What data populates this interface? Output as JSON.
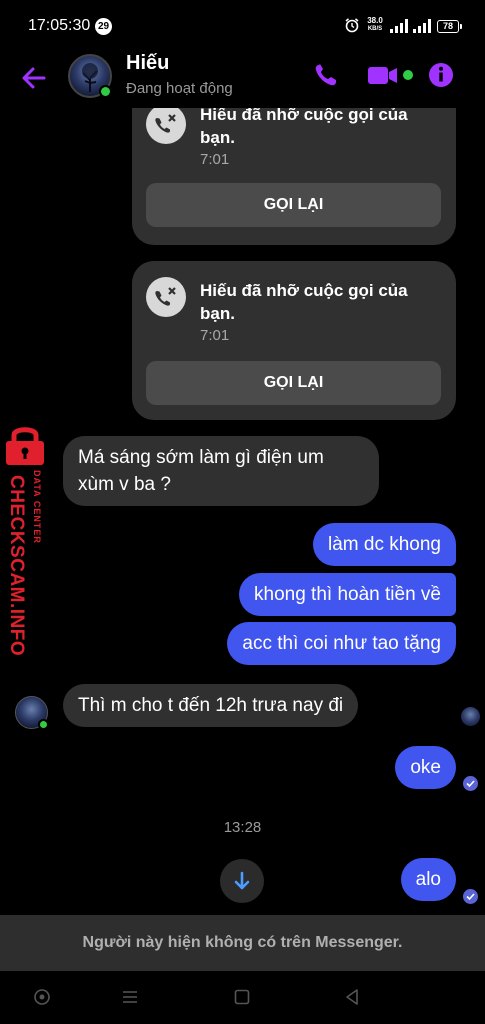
{
  "status_bar": {
    "time": "17:05:30",
    "notification_count": "29",
    "net_speed_value": "38.0",
    "net_speed_unit": "KB/S",
    "battery": "78"
  },
  "header": {
    "contact_name": "Hiếu",
    "contact_status": "Đang hoạt động",
    "accent_color": "#a033ff"
  },
  "messages": {
    "missed_call_1": {
      "text": "Hiếu đã nhỡ cuộc gọi của bạn.",
      "time": "7:01",
      "button": "GỌI LẠI"
    },
    "missed_call_2": {
      "text": "Hiếu đã nhỡ cuộc gọi của bạn.",
      "time": "7:01",
      "button": "GỌI LẠI"
    },
    "in_1": "Má sáng sớm làm gì điện um xùm v ba ?",
    "out_1": "làm dc khong",
    "out_2": "khong thì hoàn tiền về",
    "out_3": "acc thì coi như tao tặng",
    "in_2": "Thì m cho t đến 12h trưa nay đi",
    "out_4": "oke",
    "timestamp": "13:28",
    "out_5": "alo"
  },
  "watermark": {
    "main": "CHECKSCAM.INFO",
    "sub": "DATA CENTER"
  },
  "notice": "Người này hiện không có trên Messenger.",
  "colors": {
    "outgoing_bubble": "#4056ee",
    "incoming_bubble": "#303030",
    "online": "#31cc46"
  },
  "icons": {
    "back": "back-arrow-icon",
    "call": "phone-icon",
    "video": "video-camera-icon",
    "info": "info-icon",
    "missed_call": "missed-call-icon",
    "scroll_down": "arrow-down-icon"
  }
}
